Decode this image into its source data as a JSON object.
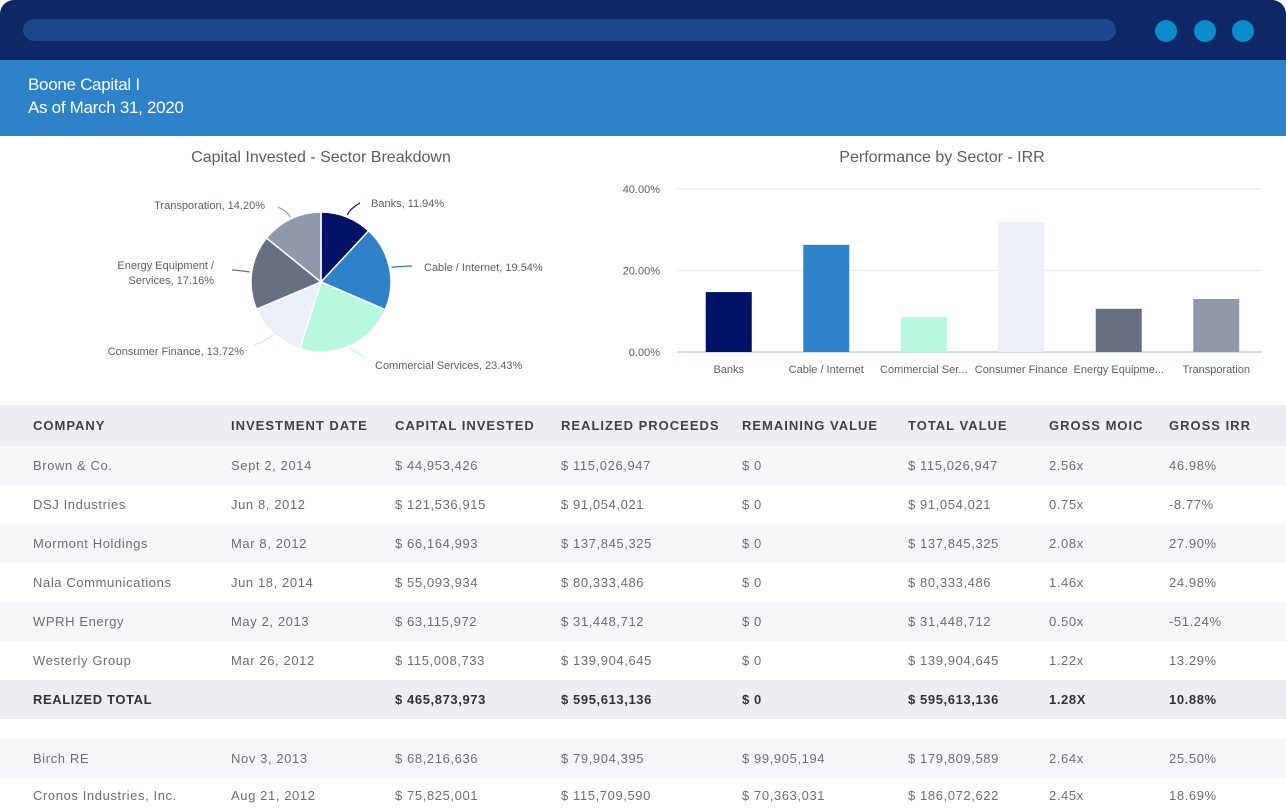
{
  "window": {
    "controls": [
      "window-dot",
      "window-dot",
      "window-dot"
    ]
  },
  "header": {
    "fund_name": "Boone Capital I",
    "as_of": "As of March 31, 2020"
  },
  "colors": {
    "titlebar": "#0e2766",
    "urlbar": "#1c488c",
    "window_dots": "#0b8ccb",
    "header": "#2d82c9",
    "table_header_bg": "#eceef2",
    "table_alt_row_bg": "#f6f7f9"
  },
  "chart_data": [
    {
      "type": "pie",
      "title": "Capital Invested - Sector Breakdown",
      "categories": [
        "Banks",
        "Cable / Internet",
        "Commercial Services",
        "Consumer Finance",
        "Energy Equipment / Services",
        "Transporation"
      ],
      "values": [
        11.94,
        19.54,
        23.43,
        13.72,
        17.16,
        14.2
      ],
      "labels": [
        "Banks, 11.94%",
        "Cable / Internet, 19.54%",
        "Commercial Services, 23.43%",
        "Consumer Finance, 13.72%",
        "Energy Equipment / Services, 17.16%",
        "Transporation, 14.20%"
      ],
      "label_lines": [
        [
          "Banks, 11.94%"
        ],
        [
          "Cable / Internet, 19.54%"
        ],
        [
          "Commercial Services, 23.43%"
        ],
        [
          "Consumer Finance, 13.72%"
        ],
        [
          "Energy Equipment /",
          "Services, 17.16%"
        ],
        [
          "Transporation, 14.20%"
        ]
      ],
      "colors": [
        "#001166",
        "#2d82c9",
        "#b6f9de",
        "#ebeff8",
        "#677083",
        "#9099ab"
      ],
      "unit": "%"
    },
    {
      "type": "bar",
      "title": "Performance by Sector - IRR",
      "categories": [
        "Banks",
        "Cable / Internet",
        "Commercial Ser...",
        "Consumer Finance",
        "Energy Equipme...",
        "Transporation"
      ],
      "values": [
        14.7,
        26.3,
        8.6,
        31.9,
        10.6,
        13.0
      ],
      "colors": [
        "#001166",
        "#2d82c9",
        "#b6f9de",
        "#ebeff8",
        "#677083",
        "#9099ab"
      ],
      "ylim": [
        0,
        40
      ],
      "yticks": [
        0,
        20,
        40
      ],
      "ytick_labels": [
        "0.00%",
        "20.00%",
        "40.00%"
      ],
      "xlabel": "",
      "ylabel": "",
      "grid": true,
      "unit": "%"
    }
  ],
  "table": {
    "columns": [
      "COMPANY",
      "INVESTMENT DATE",
      "CAPITAL INVESTED",
      "REALIZED PROCEEDS",
      "REMAINING VALUE",
      "TOTAL VALUE",
      "GROSS MOIC",
      "GROSS IRR"
    ],
    "realized_rows": [
      [
        "Brown & Co.",
        "Sept 2, 2014",
        "$ 44,953,426",
        "$ 115,026,947",
        "$ 0",
        "$ 115,026,947",
        "2.56x",
        "46.98%"
      ],
      [
        "DSJ Industries",
        "Jun 8, 2012",
        "$ 121,536,915",
        "$ 91,054,021",
        "$ 0",
        "$ 91,054,021",
        "0.75x",
        "-8.77%"
      ],
      [
        "Mormont Holdings",
        "Mar 8, 2012",
        "$ 66,164,993",
        "$ 137,845,325",
        "$ 0",
        "$ 137,845,325",
        "2.08x",
        "27.90%"
      ],
      [
        "Nala Communications",
        "Jun 18, 2014",
        "$ 55,093,934",
        "$ 80,333,486",
        "$ 0",
        "$ 80,333,486",
        "1.46x",
        "24.98%"
      ],
      [
        "WPRH Energy",
        "May 2, 2013",
        "$ 63,115,972",
        "$ 31,448,712",
        "$ 0",
        "$ 31,448,712",
        "0.50x",
        "-51.24%"
      ],
      [
        "Westerly Group",
        "Mar 26, 2012",
        "$ 115,008,733",
        "$ 139,904,645",
        "$ 0",
        "$ 139,904,645",
        "1.22x",
        "13.29%"
      ]
    ],
    "realized_total": [
      "REALIZED TOTAL",
      "",
      "$ 465,873,973",
      "$ 595,613,136",
      "$ 0",
      "$ 595,613,136",
      "1.28X",
      "10.88%"
    ],
    "unrealized_rows": [
      [
        "Birch RE",
        "Nov 3, 2013",
        "$ 68,216,636",
        "$ 79,904,395",
        "$ 99,905,194",
        "$ 179,809,589",
        "2.64x",
        "25.50%"
      ],
      [
        "Cronos Industries, Inc.",
        "Aug 21, 2012",
        "$ 75,825,001",
        "$ 115,709,590",
        "$ 70,363,031",
        "$ 186,072,622",
        "2.45x",
        "18.69%"
      ]
    ]
  }
}
